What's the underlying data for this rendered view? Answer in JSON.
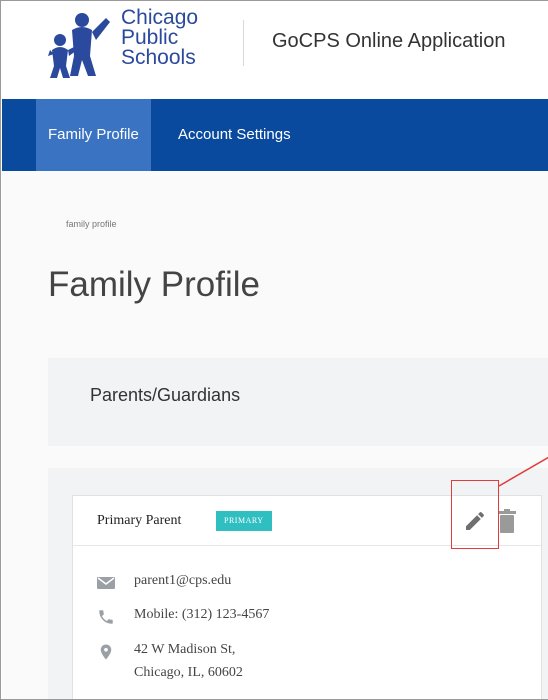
{
  "header": {
    "logo_lines": [
      "Chicago",
      "Public",
      "Schools"
    ],
    "app_title": "GoCPS Online Application"
  },
  "nav": {
    "items": [
      {
        "label": "Family Profile",
        "active": true
      },
      {
        "label": "Account Settings",
        "active": false
      }
    ]
  },
  "breadcrumb": "family profile",
  "page_title": "Family Profile",
  "section": {
    "title": "Parents/Guardians"
  },
  "parent_card": {
    "label": "Primary Parent",
    "badge": "PRIMARY",
    "email": "parent1@cps.edu",
    "phone": "Mobile: (312) 123-4567",
    "address_line1": "42 W Madison St,",
    "address_line2": "Chicago, IL, 60602",
    "icons": [
      "envelope-icon",
      "phone-icon",
      "map-pin-icon",
      "pencil-icon",
      "trash-icon"
    ]
  },
  "colors": {
    "nav_bg": "#0a4a9e",
    "nav_active": "#3a73c2",
    "badge": "#2fbfc1",
    "logo_blue": "#2b4a9e",
    "highlight": "#e23b3b"
  }
}
